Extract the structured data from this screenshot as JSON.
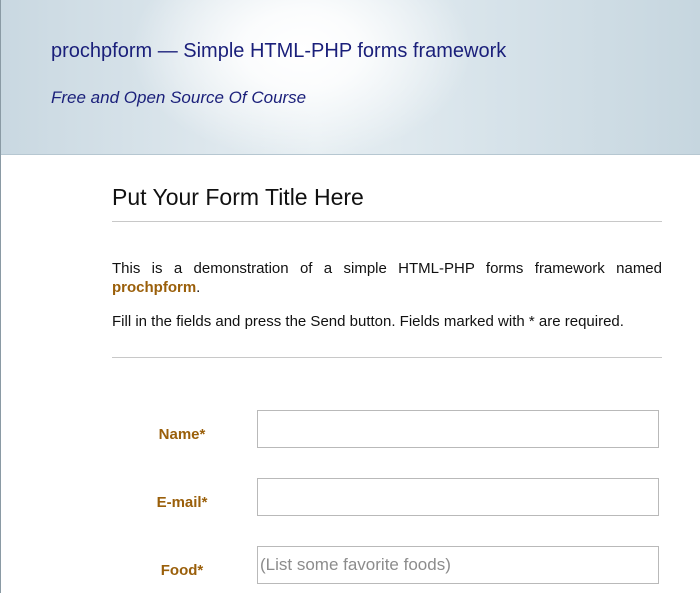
{
  "header": {
    "title": "prochpform — Simple HTML-PHP forms framework",
    "tagline": "Free and Open Source Of Course"
  },
  "form": {
    "title": "Put Your Form Title Here",
    "intro_text": "This is a demonstration of a simple HTML-PHP forms framework named ",
    "intro_brand": "prochpform",
    "intro_end": ".",
    "instructions": "Fill in the fields and press the Send button. Fields marked with * are required.",
    "fields": [
      {
        "label": "Name*",
        "value": "",
        "placeholder": ""
      },
      {
        "label": "E-mail*",
        "value": "",
        "placeholder": ""
      },
      {
        "label": "Food*",
        "value": "",
        "placeholder": "(List some favorite foods)"
      }
    ]
  },
  "colors": {
    "header_text": "#1a1f7a",
    "label_accent": "#9a5f0a"
  }
}
